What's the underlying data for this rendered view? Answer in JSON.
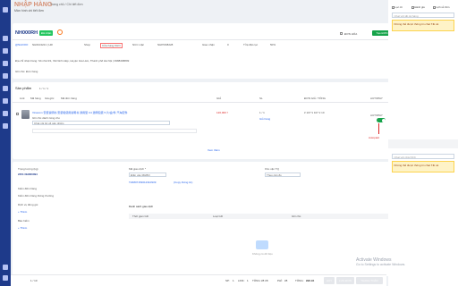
{
  "header": {
    "title": "NHẬP HÀNG",
    "breadcrumb": "Trang chủ / Chi tiết đơn",
    "subtitle": "Màn hình chi tiết đơn"
  },
  "order": {
    "code": "NH000RH",
    "status_badge": "Đã nhận",
    "id_label": "@NHOOO",
    "id_value": "NH0104221 | HR",
    "field_shop": "Shop",
    "field_store": "Cửa hàng KHO",
    "field_supplier": "NCC mặc",
    "field_supplier_val": "NHPNN8228",
    "field_ship": "Giao nhận",
    "field_ship_val": "0",
    "field_date": "Tỉ lệ đặt cọc",
    "field_date_val": "50%",
    "address": "Địa chỉ nhận hàng: Số nhà 9/1, Xã Ninh Hiệp, Huyện Gia Lâm, Thành phố Hà Nội | 0988468899",
    "note": "Ghi chú: Đơn hàng",
    "check_invoice": "ĐƠN HÓA",
    "btn_print": "Tạo ĐƠN"
  },
  "products": {
    "title": "Sản phẩm",
    "toolbar": "1 / 1 / 1",
    "filters": [
      "Link",
      "Mã hàng",
      "Giá gốc",
      "Mã đơn hàng"
    ],
    "col_price": "GIÁ",
    "col_qty": "SL",
    "col_total": "ĐƠN GIÁ / TỔNG",
    "col_auto": "AUTOPAY",
    "item_name": "Vinacom 安装说明书 安装和使用说明书 通用型 C4 透明包装 5 片/盒/件 汽车配件",
    "item_sub": "Ghi chú dành riêng cho",
    "item_input_placeholder": "Chat nội bộ về sản phẩm",
    "item_price": "120,000 ₫",
    "item_qty": "1 / 1",
    "item_qty_link": "Giỏ hàng",
    "item_total": "¥ 107 ¥ 107 ¥ 10",
    "autopay_label": "AUTOPAY",
    "annotation": "Autopaid",
    "link_more": "Xem thêm"
  },
  "detail": {
    "weight_label": "Trọng lượng (kg)",
    "weight_value": "2451  NH000094",
    "ship_fee_label": "Phí vận chuyển",
    "ship_fee_value": "0",
    "inspect_label": "Kiểm đếm hàng",
    "inspect_value": "Kiểm đếm hàng thông thường",
    "service_label": "Dịch vụ đóng gói",
    "service_value": "Theo nhóm",
    "insurance_label": "Bảo hiểm",
    "insurance_value": "Theo nhóm",
    "deposit_label": "Mã giao dịch *",
    "deposit_placeholder": "Điền vào MHBO",
    "deposit_code": "TZ4807153012310939",
    "deposit_link": "(Copy thông tin)",
    "warehouse_label": "Kho vận TQ",
    "warehouse_value": "Theo cân đo",
    "add_link1": "+ Thêm",
    "add_link2": "+ Thêm",
    "history_title": "Danh sách giao dịch",
    "history_cols": [
      "Thời gian GD",
      "Loại GD",
      "Ghi chú"
    ],
    "empty_text": "Không có dữ liệu"
  },
  "footer": {
    "left": "1 / 10",
    "sp": "SP:",
    "sp_val": "1",
    "link": "LINK:",
    "link_val": "1",
    "tong": "TỔNG:",
    "tong_val": "¥8 ¥8",
    "phi": "PHÍ:",
    "phi_val": "¥8",
    "total_label": "TỔNG:",
    "total_val": "¥96.94",
    "btn1": "HỦY",
    "btn2": "LƯU ĐƠN",
    "btn3": "THANH TOÁN"
  },
  "right_panel": {
    "check1": "Lọc cũ",
    "check2": "Đánh giá",
    "check3": "Lịch sử đơn",
    "select1": "Chat với tất cả hàng",
    "warn1": "Không thể được thông tin chat Tất cả",
    "select2": "Chat với nhà NCC",
    "warn2": "Không thể được thông tin chat Tất cả"
  },
  "watermark": {
    "line1": "Activate Windows",
    "line2": "Go to Settings to activate Windows."
  },
  "colors": {
    "brand": "#1e3a8a",
    "accent_green": "#16a34a",
    "warning": "#fef3c7",
    "danger": "#dc2626"
  }
}
